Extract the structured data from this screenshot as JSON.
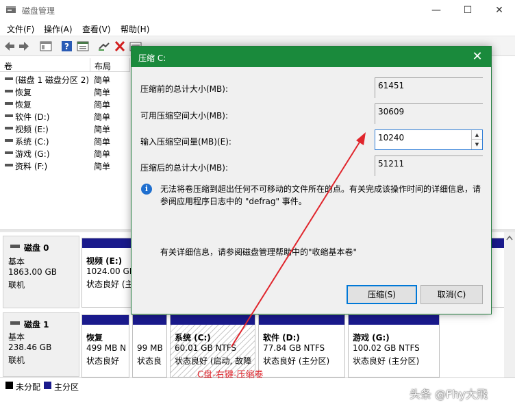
{
  "window": {
    "title": "磁盘管理",
    "minimize": "—",
    "maximize": "☐",
    "close": "✕"
  },
  "menu": [
    "文件(F)",
    "操作(A)",
    "查看(V)",
    "帮助(H)"
  ],
  "volume_list": {
    "headers": [
      "卷",
      "布局"
    ],
    "rows": [
      {
        "name": "(磁盘 1 磁盘分区 2)",
        "layout": "简单"
      },
      {
        "name": "恢复",
        "layout": "简单"
      },
      {
        "name": "恢复",
        "layout": "简单"
      },
      {
        "name": "软件 (D:)",
        "layout": "简单"
      },
      {
        "name": "视频 (E:)",
        "layout": "简单"
      },
      {
        "name": "系统 (C:)",
        "layout": "简单"
      },
      {
        "name": "游戏 (G:)",
        "layout": "简单"
      },
      {
        "name": "资料 (F:)",
        "layout": "简单"
      }
    ]
  },
  "disks": [
    {
      "name": "磁盘 0",
      "type": "基本",
      "size": "1863.00 GB",
      "status": "联机",
      "partitions": [
        {
          "name": "视频 (E:)",
          "line1": "1024.00 GB",
          "line2": "状态良好 (主"
        }
      ]
    },
    {
      "name": "磁盘 1",
      "type": "基本",
      "size": "238.46 GB",
      "status": "联机",
      "partitions": [
        {
          "name": "恢复",
          "line1": "499 MB N",
          "line2": "状态良好"
        },
        {
          "name": "",
          "line1": "99 MB",
          "line2": "状态良"
        },
        {
          "name": "系统 (C:)",
          "line1": "60.01 GB NTFS",
          "line2": "状态良好 (启动, 故障"
        },
        {
          "name": "软件 (D:)",
          "line1": "77.84 GB NTFS",
          "line2": "状态良好 (主分区)"
        },
        {
          "name": "游戏 (G:)",
          "line1": "100.02 GB NTFS",
          "line2": "状态良好 (主分区)"
        }
      ]
    }
  ],
  "legend": [
    {
      "label": "未分配",
      "color": "#000000"
    },
    {
      "label": "主分区",
      "color": "#1a1a8c"
    }
  ],
  "dialog": {
    "title": "压缩 C:",
    "close": "✕",
    "fields": [
      {
        "label": "压缩前的总计大小(MB):",
        "value": "61451"
      },
      {
        "label": "可用压缩空间大小(MB):",
        "value": "30609"
      },
      {
        "label": "输入压缩空间量(MB)(E):",
        "value": "10240"
      },
      {
        "label": "压缩后的总计大小(MB):",
        "value": "51211"
      }
    ],
    "info_icon": "i",
    "info_text": "无法将卷压缩到超出任何不可移动的文件所在的点。有关完成该操作时间的详细信息，请参阅应用程序日志中的 \"defrag\" 事件。",
    "detail_text": "有关详细信息，请参阅磁盘管理帮助中的\"收缩基本卷\"",
    "buttons": {
      "shrink": "压缩(S)",
      "cancel": "取消(C)"
    }
  },
  "annotation": {
    "text": "C盘-右键-压缩卷",
    "color": "#e0252c"
  },
  "watermark": "头条 @Fhy大飛",
  "colors": {
    "dialog_title": "#1a8a3c",
    "primary_partition": "#1a1a8c"
  }
}
